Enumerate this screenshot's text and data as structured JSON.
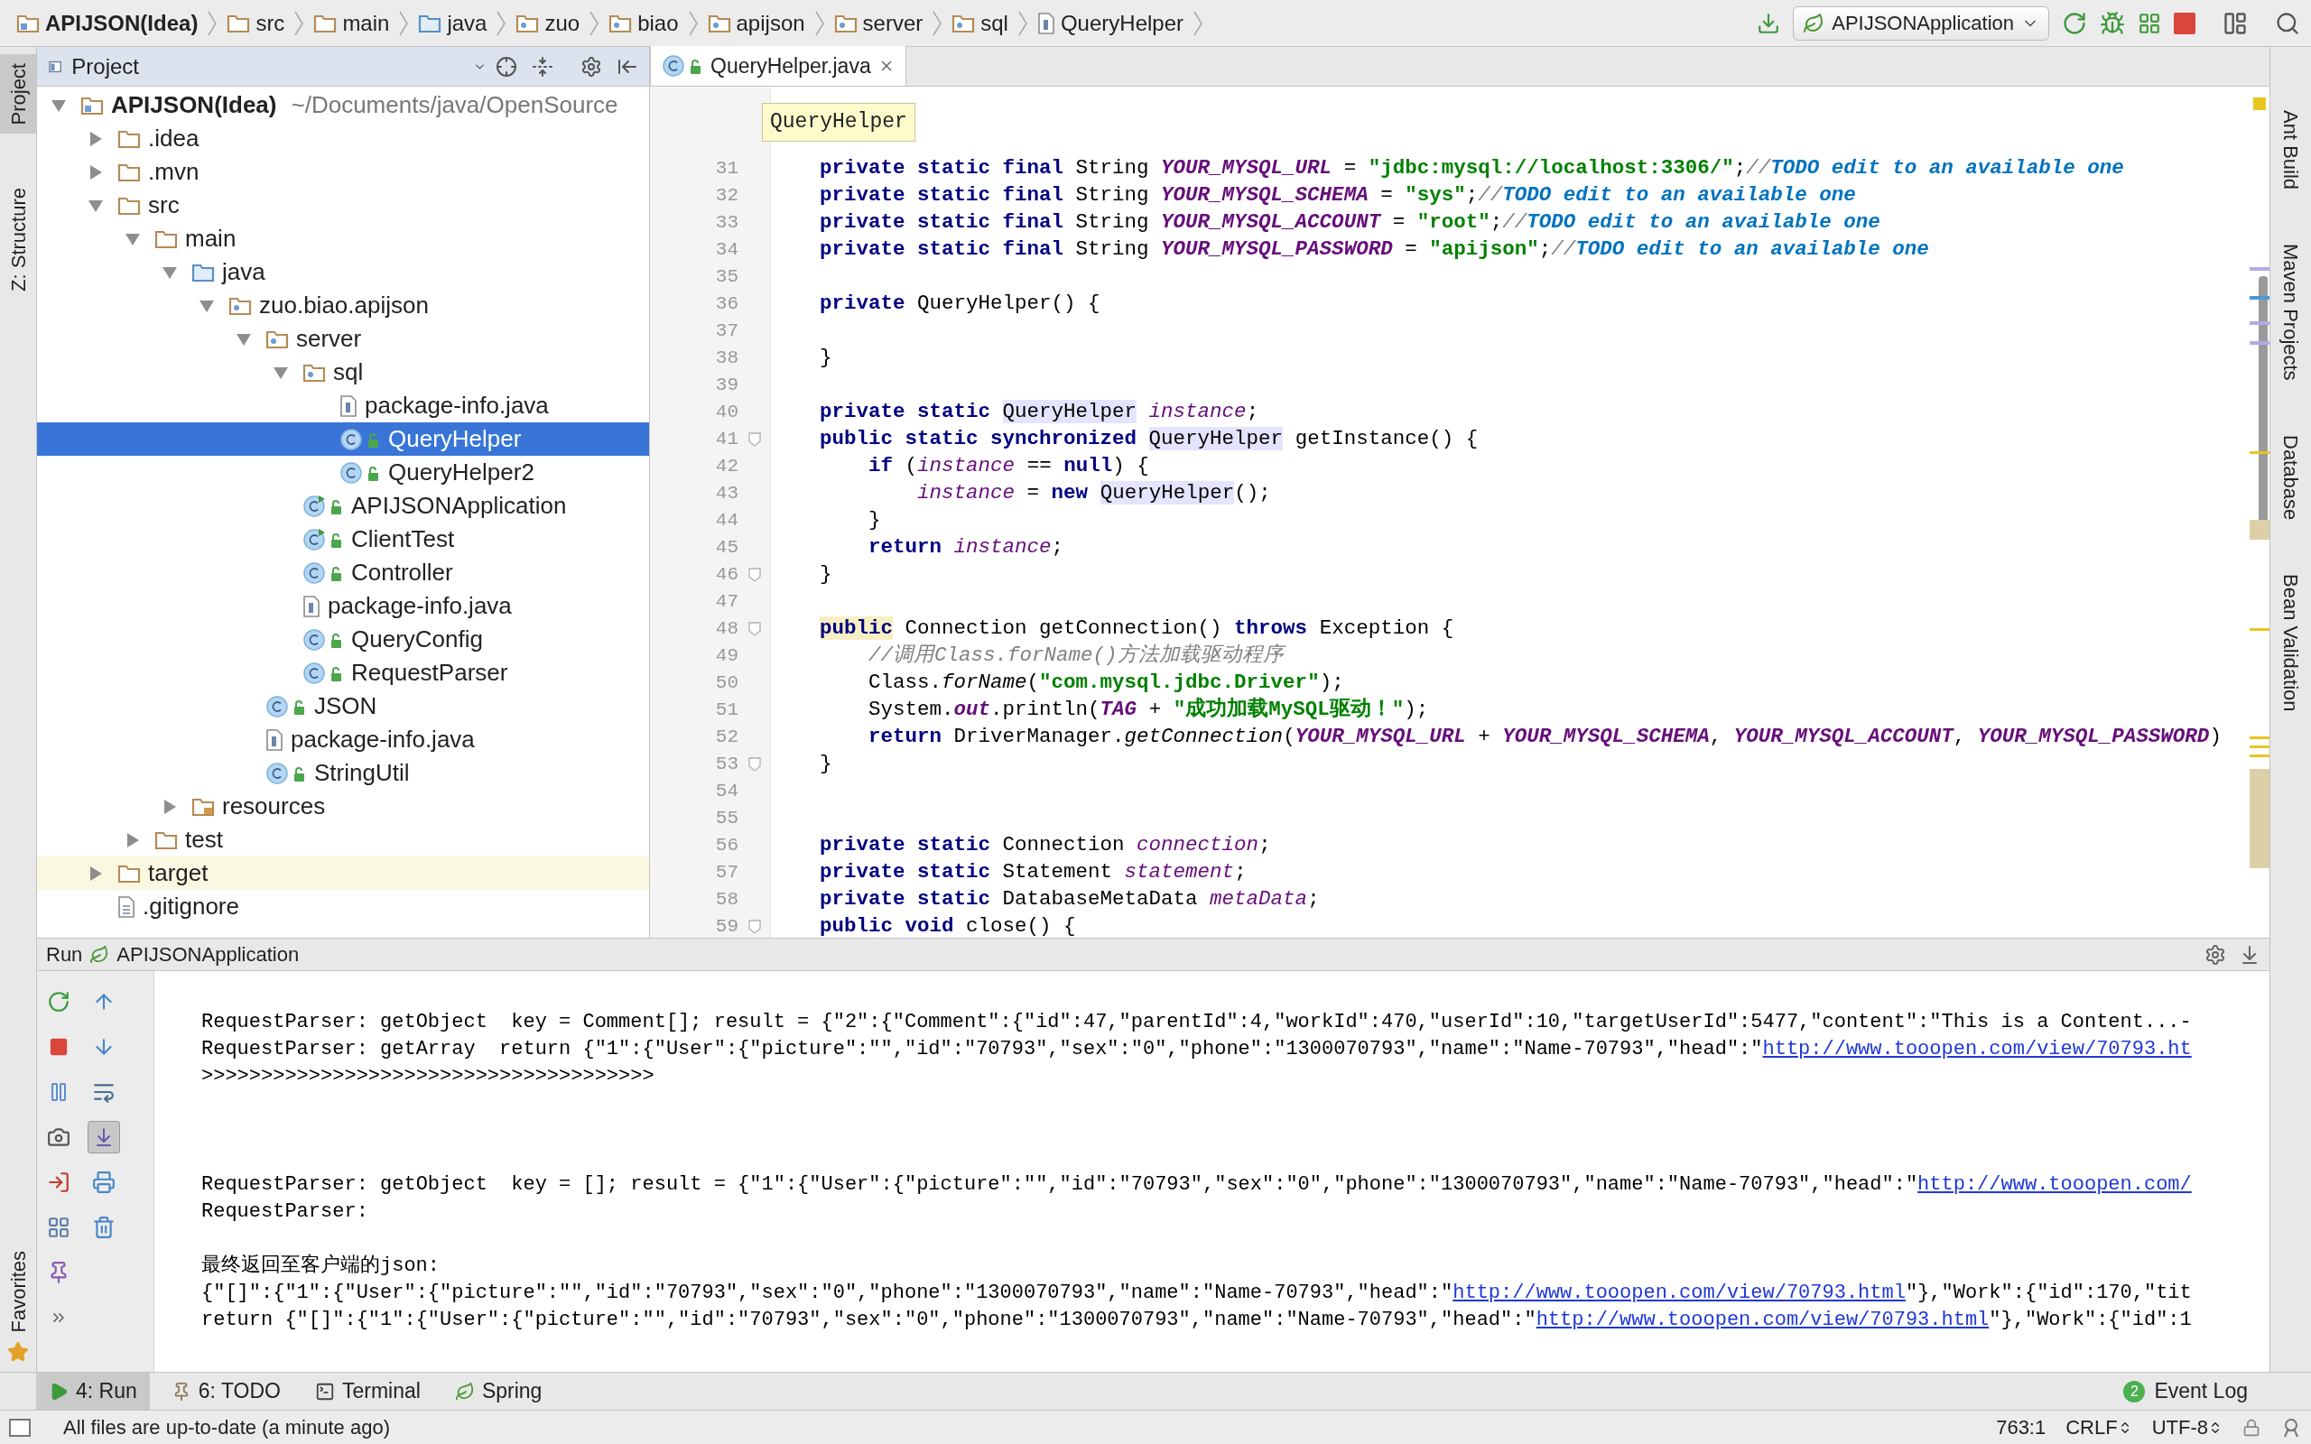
{
  "breadcrumbs": [
    {
      "label": "APIJSON(Idea)",
      "kind": "module"
    },
    {
      "label": "src",
      "kind": "folder"
    },
    {
      "label": "main",
      "kind": "folder"
    },
    {
      "label": "java",
      "kind": "source-folder"
    },
    {
      "label": "zuo",
      "kind": "package"
    },
    {
      "label": "biao",
      "kind": "package"
    },
    {
      "label": "apijson",
      "kind": "package"
    },
    {
      "label": "server",
      "kind": "package"
    },
    {
      "label": "sql",
      "kind": "package"
    },
    {
      "label": "QueryHelper",
      "kind": "class"
    }
  ],
  "run_config": {
    "label": "APIJSONApplication"
  },
  "left_tools": [
    {
      "label": "Project",
      "selected": true
    },
    {
      "label": "Z: Structure",
      "selected": false
    }
  ],
  "left_bottom_tools": [
    {
      "label": "Favorites"
    }
  ],
  "right_tools": [
    {
      "label": "Ant Build"
    },
    {
      "label": "Maven Projects"
    },
    {
      "label": "Database"
    },
    {
      "label": "Bean Validation"
    }
  ],
  "project": {
    "title": "Project",
    "tree": [
      {
        "label": "APIJSON(Idea)",
        "path": "~/Documents/java/OpenSource",
        "kind": "module",
        "expanded": true,
        "selected": false,
        "highlighted": false,
        "children": [
          {
            "label": ".idea",
            "kind": "folder",
            "expanded": false,
            "selected": false,
            "highlighted": false
          },
          {
            "label": ".mvn",
            "kind": "folder",
            "expanded": false,
            "selected": false,
            "highlighted": false
          },
          {
            "label": "src",
            "kind": "folder",
            "expanded": true,
            "selected": false,
            "highlighted": false,
            "children": [
              {
                "label": "main",
                "kind": "folder",
                "expanded": true,
                "selected": false,
                "highlighted": false,
                "children": [
                  {
                    "label": "java",
                    "kind": "source-folder",
                    "expanded": true,
                    "selected": false,
                    "highlighted": false,
                    "children": [
                      {
                        "label": "zuo.biao.apijson",
                        "kind": "package",
                        "expanded": true,
                        "selected": false,
                        "highlighted": false,
                        "children": [
                          {
                            "label": "server",
                            "kind": "package",
                            "expanded": true,
                            "selected": false,
                            "highlighted": false,
                            "children": [
                              {
                                "label": "sql",
                                "kind": "package",
                                "expanded": true,
                                "selected": false,
                                "highlighted": false,
                                "children": [
                                  {
                                    "label": "package-info.java",
                                    "kind": "java-info",
                                    "selected": false,
                                    "highlighted": false
                                  },
                                  {
                                    "label": "QueryHelper",
                                    "kind": "class",
                                    "selected": true,
                                    "highlighted": false
                                  },
                                  {
                                    "label": "QueryHelper2",
                                    "kind": "class",
                                    "selected": false,
                                    "highlighted": false
                                  }
                                ]
                              },
                              {
                                "label": "APIJSONApplication",
                                "kind": "class-run",
                                "selected": false,
                                "highlighted": false
                              },
                              {
                                "label": "ClientTest",
                                "kind": "class-run",
                                "selected": false,
                                "highlighted": false
                              },
                              {
                                "label": "Controller",
                                "kind": "class",
                                "selected": false,
                                "highlighted": false
                              },
                              {
                                "label": "package-info.java",
                                "kind": "java-info",
                                "selected": false,
                                "highlighted": false
                              },
                              {
                                "label": "QueryConfig",
                                "kind": "class",
                                "selected": false,
                                "highlighted": false
                              },
                              {
                                "label": "RequestParser",
                                "kind": "class",
                                "selected": false,
                                "highlighted": false
                              }
                            ]
                          },
                          {
                            "label": "JSON",
                            "kind": "class",
                            "selected": false,
                            "highlighted": false
                          },
                          {
                            "label": "package-info.java",
                            "kind": "java-info",
                            "selected": false,
                            "highlighted": false
                          },
                          {
                            "label": "StringUtil",
                            "kind": "class",
                            "selected": false,
                            "highlighted": false
                          }
                        ]
                      }
                    ]
                  },
                  {
                    "label": "resources",
                    "kind": "resources",
                    "expanded": false,
                    "selected": false,
                    "highlighted": false
                  }
                ]
              },
              {
                "label": "test",
                "kind": "folder",
                "expanded": false,
                "selected": false,
                "highlighted": false
              }
            ]
          },
          {
            "label": "target",
            "kind": "folder",
            "expanded": false,
            "selected": false,
            "highlighted": true
          },
          {
            "label": ".gitignore",
            "kind": "text-file",
            "selected": false,
            "highlighted": false
          }
        ]
      }
    ]
  },
  "editor": {
    "tab": {
      "label": "QueryHelper.java",
      "selected": true
    },
    "tooltip": "QueryHelper",
    "lines": [
      {
        "num": "31",
        "fold": false,
        "tokens": [
          {
            "text": "    private static final",
            "kind": "kw"
          },
          {
            "text": " String ",
            "kind": "plain"
          },
          {
            "text": "YOUR_MYSQL_URL",
            "kind": "const"
          },
          {
            "text": " = ",
            "kind": "plain"
          },
          {
            "text": "\"jdbc:mysql://localhost:3306/\"",
            "kind": "str"
          },
          {
            "text": ";",
            "kind": "plain"
          },
          {
            "text": "//",
            "kind": "comment"
          },
          {
            "text": "TODO edit to an available one",
            "kind": "todo"
          }
        ]
      },
      {
        "num": "32",
        "fold": false,
        "tokens": [
          {
            "text": "    private static final",
            "kind": "kw"
          },
          {
            "text": " String ",
            "kind": "plain"
          },
          {
            "text": "YOUR_MYSQL_SCHEMA",
            "kind": "const"
          },
          {
            "text": " = ",
            "kind": "plain"
          },
          {
            "text": "\"sys\"",
            "kind": "str"
          },
          {
            "text": ";",
            "kind": "plain"
          },
          {
            "text": "//",
            "kind": "comment"
          },
          {
            "text": "TODO edit to an available one",
            "kind": "todo"
          }
        ]
      },
      {
        "num": "33",
        "fold": false,
        "tokens": [
          {
            "text": "    private static final",
            "kind": "kw"
          },
          {
            "text": " String ",
            "kind": "plain"
          },
          {
            "text": "YOUR_MYSQL_ACCOUNT",
            "kind": "const"
          },
          {
            "text": " = ",
            "kind": "plain"
          },
          {
            "text": "\"root\"",
            "kind": "str"
          },
          {
            "text": ";",
            "kind": "plain"
          },
          {
            "text": "//",
            "kind": "comment"
          },
          {
            "text": "TODO edit to an available one",
            "kind": "todo"
          }
        ]
      },
      {
        "num": "34",
        "fold": false,
        "tokens": [
          {
            "text": "    private static final",
            "kind": "kw"
          },
          {
            "text": " String ",
            "kind": "plain"
          },
          {
            "text": "YOUR_MYSQL_PASSWORD",
            "kind": "const"
          },
          {
            "text": " = ",
            "kind": "plain"
          },
          {
            "text": "\"apijson\"",
            "kind": "str"
          },
          {
            "text": ";",
            "kind": "plain"
          },
          {
            "text": "//",
            "kind": "comment"
          },
          {
            "text": "TODO edit to an available one",
            "kind": "todo"
          }
        ]
      },
      {
        "num": "35",
        "fold": false
      },
      {
        "num": "36",
        "fold": false,
        "tokens": [
          {
            "text": "    private",
            "kind": "kw"
          },
          {
            "text": " QueryHelper() {",
            "kind": "plain"
          }
        ]
      },
      {
        "num": "37",
        "fold": false
      },
      {
        "num": "38",
        "fold": false,
        "tokens": [
          {
            "text": "    }",
            "kind": "plain"
          }
        ]
      },
      {
        "num": "39",
        "fold": false
      },
      {
        "num": "40",
        "fold": false,
        "tokens": [
          {
            "text": "    private static",
            "kind": "kw"
          },
          {
            "text": " QueryHelper",
            "kind": "usage"
          },
          {
            "text": " instance",
            "kind": "field"
          },
          {
            "text": ";",
            "kind": "plain"
          }
        ]
      },
      {
        "num": "41",
        "fold": true,
        "tokens": [
          {
            "text": "    public static synchronized",
            "kind": "kw"
          },
          {
            "text": " QueryHelper",
            "kind": "usage"
          },
          {
            "text": " getInstance() {",
            "kind": "plain"
          }
        ]
      },
      {
        "num": "42",
        "fold": false,
        "tokens": [
          {
            "text": "        if",
            "kind": "kw"
          },
          {
            "text": " (",
            "kind": "plain"
          },
          {
            "text": "instance",
            "kind": "field"
          },
          {
            "text": " == ",
            "kind": "plain"
          },
          {
            "text": "null",
            "kind": "kw"
          },
          {
            "text": ") {",
            "kind": "plain"
          }
        ]
      },
      {
        "num": "43",
        "fold": false,
        "tokens": [
          {
            "text": "            instance",
            "kind": "field"
          },
          {
            "text": " = ",
            "kind": "plain"
          },
          {
            "text": "new",
            "kind": "kw"
          },
          {
            "text": " QueryHelper",
            "kind": "usage"
          },
          {
            "text": "();",
            "kind": "plain"
          }
        ]
      },
      {
        "num": "44",
        "fold": false,
        "tokens": [
          {
            "text": "        }",
            "kind": "plain"
          }
        ]
      },
      {
        "num": "45",
        "fold": false,
        "tokens": [
          {
            "text": "        return",
            "kind": "kw"
          },
          {
            "text": " instance",
            "kind": "field"
          },
          {
            "text": ";",
            "kind": "plain"
          }
        ]
      },
      {
        "num": "46",
        "fold": true,
        "tokens": [
          {
            "text": "    }",
            "kind": "plain"
          }
        ]
      },
      {
        "num": "47",
        "fold": false
      },
      {
        "num": "48",
        "fold": true,
        "tokens": [
          {
            "text": "    public",
            "kind": "kw-marked"
          },
          {
            "text": " Connection getConnection() ",
            "kind": "plain"
          },
          {
            "text": "throws",
            "kind": "kw"
          },
          {
            "text": " Exception {",
            "kind": "plain"
          }
        ]
      },
      {
        "num": "49",
        "fold": false,
        "tokens": [
          {
            "text": "        //调用Class.forName()方法加载驱动程序",
            "kind": "comment"
          }
        ]
      },
      {
        "num": "50",
        "fold": false,
        "tokens": [
          {
            "text": "        Class.",
            "kind": "plain"
          },
          {
            "text": "forName",
            "kind": "call"
          },
          {
            "text": "(",
            "kind": "plain"
          },
          {
            "text": "\"com.mysql.jdbc.Driver\"",
            "kind": "str"
          },
          {
            "text": ");",
            "kind": "plain"
          }
        ]
      },
      {
        "num": "51",
        "fold": false,
        "tokens": [
          {
            "text": "        System.",
            "kind": "plain"
          },
          {
            "text": "out",
            "kind": "const"
          },
          {
            "text": ".println(",
            "kind": "plain"
          },
          {
            "text": "TAG",
            "kind": "const"
          },
          {
            "text": " + ",
            "kind": "plain"
          },
          {
            "text": "\"成功加载MySQL驱动！\"",
            "kind": "str"
          },
          {
            "text": ");",
            "kind": "plain"
          }
        ]
      },
      {
        "num": "52",
        "fold": false,
        "tokens": [
          {
            "text": "        return",
            "kind": "kw"
          },
          {
            "text": " DriverManager.",
            "kind": "plain"
          },
          {
            "text": "getConnection",
            "kind": "call"
          },
          {
            "text": "(",
            "kind": "plain"
          },
          {
            "text": "YOUR_MYSQL_URL",
            "kind": "const"
          },
          {
            "text": " + ",
            "kind": "plain"
          },
          {
            "text": "YOUR_MYSQL_SCHEMA",
            "kind": "const"
          },
          {
            "text": ", ",
            "kind": "plain"
          },
          {
            "text": "YOUR_MYSQL_ACCOUNT",
            "kind": "const"
          },
          {
            "text": ", ",
            "kind": "plain"
          },
          {
            "text": "YOUR_MYSQL_PASSWORD",
            "kind": "const"
          },
          {
            "text": ")",
            "kind": "plain"
          }
        ]
      },
      {
        "num": "53",
        "fold": true,
        "tokens": [
          {
            "text": "    }",
            "kind": "plain"
          }
        ]
      },
      {
        "num": "54",
        "fold": false
      },
      {
        "num": "55",
        "fold": false
      },
      {
        "num": "56",
        "fold": false,
        "tokens": [
          {
            "text": "    private static",
            "kind": "kw"
          },
          {
            "text": " Connection ",
            "kind": "plain"
          },
          {
            "text": "connection",
            "kind": "field"
          },
          {
            "text": ";",
            "kind": "plain"
          }
        ]
      },
      {
        "num": "57",
        "fold": false,
        "tokens": [
          {
            "text": "    private static",
            "kind": "kw"
          },
          {
            "text": " Statement ",
            "kind": "plain"
          },
          {
            "text": "statement",
            "kind": "field"
          },
          {
            "text": ";",
            "kind": "plain"
          }
        ]
      },
      {
        "num": "58",
        "fold": false,
        "tokens": [
          {
            "text": "    private static",
            "kind": "kw"
          },
          {
            "text": " DatabaseMetaData ",
            "kind": "plain"
          },
          {
            "text": "metaData",
            "kind": "field"
          },
          {
            "text": ";",
            "kind": "plain"
          }
        ]
      },
      {
        "num": "59",
        "fold": true,
        "tokens": [
          {
            "text": "    public void",
            "kind": "kw"
          },
          {
            "text": " close() {",
            "kind": "plain"
          }
        ]
      }
    ]
  },
  "run": {
    "label": "Run",
    "config": "APIJSONApplication",
    "scroll_to_end": {
      "on": true
    },
    "blocks": [
      [
        [
          {
            "text": "RequestParser: getObject  key = Comment[]; result = {\"2\":{\"Comment\":{\"id\":47,\"parentId\":4,\"workId\":470,\"userId\":10,\"targetUserId\":5477,\"content\":\"This is a Content...-",
            "kind": "text"
          }
        ],
        [
          {
            "text": "RequestParser: getArray  return {\"1\":{\"User\":{\"picture\":\"\",\"id\":\"70793\",\"sex\":\"0\",\"phone\":\"1300070793\",\"name\":\"Name-70793\",\"head\":\"",
            "kind": "text"
          },
          {
            "text": "http://www.tooopen.com/view/70793.ht",
            "kind": "link"
          }
        ],
        [
          {
            "text": ">>>>>>>>>>>>>>>>>>>>>>>>>>>>>>>>>>>>>>",
            "kind": "text"
          }
        ]
      ],
      [
        [
          {
            "text": "RequestParser: getObject  key = []; result = {\"1\":{\"User\":{\"picture\":\"\",\"id\":\"70793\",\"sex\":\"0\",\"phone\":\"1300070793\",\"name\":\"Name-70793\",\"head\":\"",
            "kind": "text"
          },
          {
            "text": "http://www.tooopen.com/",
            "kind": "link"
          }
        ],
        [
          {
            "text": "RequestParser:",
            "kind": "text"
          }
        ]
      ],
      [
        [
          {
            "text": "最终返回至客户端的json:",
            "kind": "text"
          }
        ],
        [
          {
            "text": "{\"[]\":{\"1\":{\"User\":{\"picture\":\"\",\"id\":\"70793\",\"sex\":\"0\",\"phone\":\"1300070793\",\"name\":\"Name-70793\",\"head\":\"",
            "kind": "text"
          },
          {
            "text": "http://www.tooopen.com/view/70793.html",
            "kind": "link"
          },
          {
            "text": "\"},\"Work\":{\"id\":170,\"tit",
            "kind": "text"
          }
        ],
        [
          {
            "text": "return {\"[]\":{\"1\":{\"User\":{\"picture\":\"\",\"id\":\"70793\",\"sex\":\"0\",\"phone\":\"1300070793\",\"name\":\"Name-70793\",\"head\":\"",
            "kind": "text"
          },
          {
            "text": "http://www.tooopen.com/view/70793.html",
            "kind": "link"
          },
          {
            "text": "\"},\"Work\":{\"id\":1",
            "kind": "text"
          }
        ]
      ]
    ]
  },
  "bottom_tabs": [
    {
      "label": "4: Run",
      "kind": "run",
      "selected": true
    },
    {
      "label": "6: TODO",
      "kind": "todo",
      "selected": false
    },
    {
      "label": "Terminal",
      "kind": "terminal",
      "selected": false
    },
    {
      "label": "Spring",
      "kind": "spring",
      "selected": false
    }
  ],
  "event_log": {
    "label": "Event Log",
    "count": "2"
  },
  "status_bar": {
    "message": "All files are up-to-date (a minute ago)",
    "position": "763:1",
    "line_separator": "CRLF",
    "encoding": "UTF-8"
  }
}
